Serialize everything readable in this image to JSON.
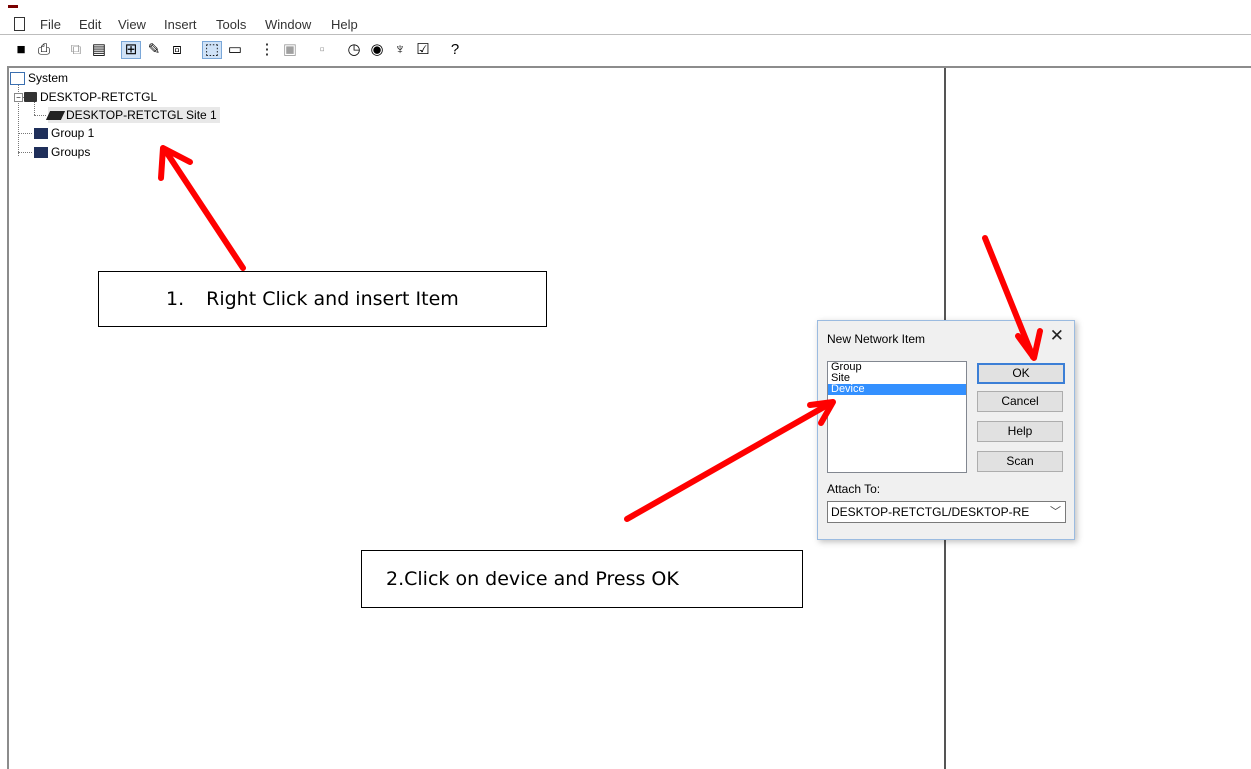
{
  "menubar": {
    "items": [
      "File",
      "Edit",
      "View",
      "Insert",
      "Tools",
      "Window",
      "Help"
    ]
  },
  "toolbar": {
    "icons": [
      "save-icon",
      "print-icon",
      "copy-icon",
      "properties-icon",
      "insert-item-icon",
      "edit-icon",
      "network-icon",
      "select-icon",
      "preview-icon",
      "tree-icon",
      "device-icon",
      "monitor-icon",
      "clock-icon",
      "database-icon",
      "connect-icon",
      "check-icon",
      "help-icon"
    ]
  },
  "tree": {
    "root": "System",
    "computer": "DESKTOP-RETCTGL",
    "site": "DESKTOP-RETCTGL Site 1",
    "group1": "Group 1",
    "groups": "Groups"
  },
  "callouts": {
    "step1_number": "1.",
    "step1_text": "Right Click and insert Item",
    "step2_text": "2.Click on device and Press OK"
  },
  "dialog": {
    "title": "New Network Item",
    "close": "✕",
    "list_items": [
      "Group",
      "Site",
      "Device"
    ],
    "selected_item": "Device",
    "ok_label": "OK",
    "cancel_label": "Cancel",
    "help_label": "Help",
    "scan_label": "Scan",
    "attach_label": "Attach To:",
    "attach_value": "DESKTOP-RETCTGL/DESKTOP-RE"
  },
  "colors": {
    "annotation_arrow": "#ff0000",
    "selection": "#3390ff"
  }
}
